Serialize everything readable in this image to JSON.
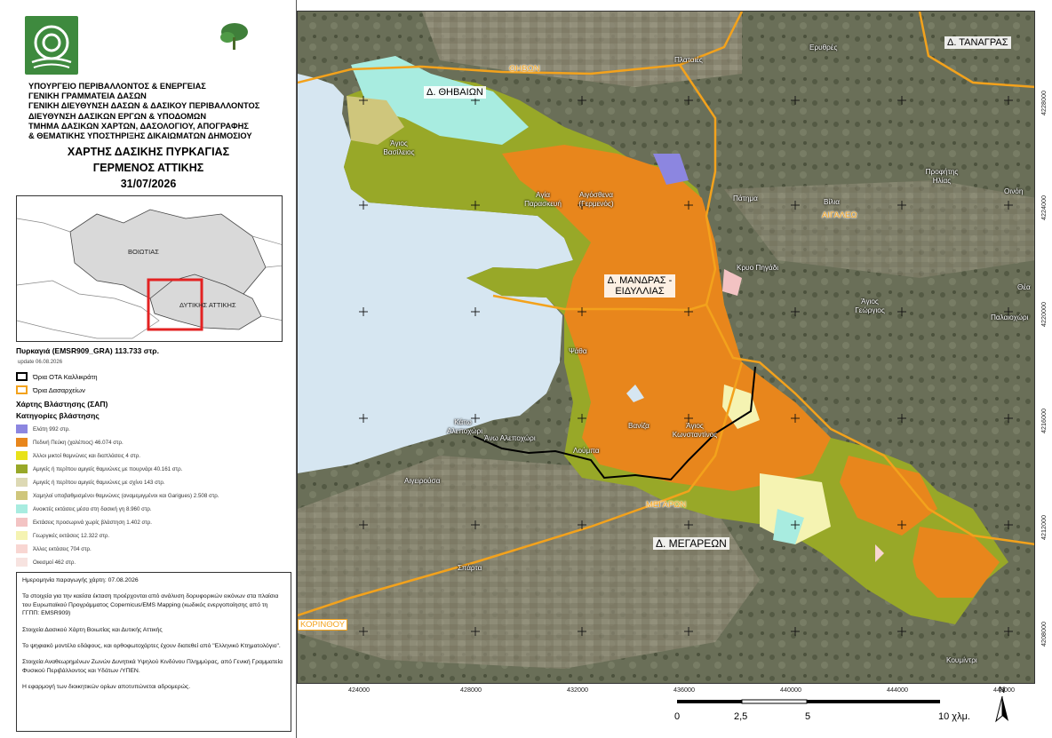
{
  "header": {
    "org_lines": [
      "ΥΠΟΥΡΓΕΙΟ ΠΕΡΙΒΑΛΛΟΝΤΟΣ & ΕΝΕΡΓΕΙΑΣ",
      "ΓΕΝΙΚΗ ΓΡΑΜΜΑΤΕΙΑ ΔΑΣΩΝ",
      "ΓΕΝΙΚΗ ΔΙΕΥΘΥΝΣΗ ΔΑΣΩΝ & ΔΑΣΙΚΟΥ ΠΕΡΙΒΑΛΛΟΝΤΟΣ",
      "ΔΙΕΥΘΥΝΣΗ ΔΑΣΙΚΩΝ ΕΡΓΩΝ & ΥΠΟΔΟΜΩΝ",
      "ΤΜΗΜΑ ΔΑΣΙΚΩΝ ΧΑΡΤΩΝ, ΔΑΣΟΛΟΓΙΟΥ, ΑΠΟΓΡΑΦΗΣ",
      "& ΘΕΜΑΤΙΚΗΣ ΥΠΟΣΤΗΡΙΞΗΣ ΔΙΚΑΙΩΜΑΤΩΝ ΔΗΜΟΣΙΟΥ"
    ],
    "title_1": "ΧΑΡΤΗΣ ΔΑΣΙΚΗΣ ΠΥΡΚΑΓΙΑΣ",
    "title_2": "ΓΕΡΜΕΝΟΣ ΑΤΤΙΚΗΣ",
    "date": "31/07/2026"
  },
  "inset": {
    "label_voiotias": "ΒΟΙΩΤΙΑΣ",
    "label_dytikis": "ΔΥΤΙΚΗΣ ΑΤΤΙΚΗΣ"
  },
  "legend": {
    "fire_title": "Πυρκαγιά (EMSR909_GRA)  113.733 στρ.",
    "fire_update": "update 06.08.2026",
    "ota_line": "Όρια ΟΤΑ Καλλικράτη",
    "dasarx_line": "Όρια Δασαρχείων",
    "vegetation_title": "Χάρτης Βλάστησης (ΣΑΠ)",
    "categories_title": "Κατηγορίες βλάστησης",
    "categories": [
      {
        "label": "Ελάτη 992 στρ.",
        "color": "#8c86e0"
      },
      {
        "label": "Πεδινή Πεύκη (χαλέπιος) 46.074 στρ.",
        "color": "#e8861c"
      },
      {
        "label": "Άλλοι μικτοί θαμνώνες και διαπλάσεις 4 στρ.",
        "color": "#e8e21a"
      },
      {
        "label": "Αμιγείς ή περίπου αμιγείς θαμνώνες με πουρνάρι 40.161 στρ.",
        "color": "#98a828"
      },
      {
        "label": "Αμιγείς ή περίπου αμιγείς θαμνώνες με σχίνο 143 στρ.",
        "color": "#ddd9b4"
      },
      {
        "label": "Χαμηλοί υποβαθμισμένοι θαμνώνες (αναμεμιγμένοι και Garigues) 2.508 στρ.",
        "color": "#cfc67c"
      },
      {
        "label": "Ανοικτές εκτάσεις μέσα στη δασική γη 8.960 στρ.",
        "color": "#a8ece0"
      },
      {
        "label": "Εκτάσεις προσωρινά χωρίς βλάστηση 1.402 στρ.",
        "color": "#f3c3c3"
      },
      {
        "label": "Γεωργικές εκτάσεις 12.322 στρ.",
        "color": "#f5f3b2"
      },
      {
        "label": "Άλλες εκτάσεις 704 στρ.",
        "color": "#f8d6d2"
      },
      {
        "label": "Οικισμοί 462 στρ.",
        "color": "#f7e3e0"
      }
    ]
  },
  "notes": {
    "date_line": "Ημερομηνία παραγωγής χάρτη: 07.08.2026",
    "p1": "Τα στοιχεία για την καείσα έκταση προέρχονται από ανάλυση δορυφορικών εικόνων στα πλαίσια του Ευρωπαϊκού Προγράμματος Copernicus/EMS Mapping (κωδικός ενεργοποίησης από τη ΓΓΠΠ: EMSR909)",
    "p2": "Στοιχεία Δασικού Χάρτη Βοιωτίας και Δυτικής Αττικής",
    "p3": "Το ψηφιακό μοντέλο εδάφους, και ορθοφωτοχάρτες έχουν διατεθεί από \"Ελληνικό Κτηματολόγιο\".",
    "p4": "Στοιχεία Αναθεωρημένων Ζωνών Δυνητικά Υψηλού Κινδύνου Πλημμύρας, από Γενική Γραμματεία Φυσικού Περιβάλλοντος και Υδάτων /ΥΠΕΝ.",
    "p5": "Η εφαρμογή των διοικητικών ορίων αποτυπώνεται αδρομερώς."
  },
  "map": {
    "places": {
      "plataies": "Πλαταιές",
      "erythres": "Ερυθρές",
      "agios_vasileios": "Άγιος Βασίλειος",
      "agia_paraskevi": "Αγία Παρασκευή",
      "aigosthena": "Αιγόσθενα (Γερμενός)",
      "patima": "Πάτημα",
      "vilia": "Βίλια",
      "profitis_ilias": "Προφήτης Ηλίας",
      "oinoi": "Οινόη",
      "kryo_pigadi": "Κρυο Πηγάδι",
      "agios_georgios": "Άγιος Γεώργιος",
      "thea": "Θέα",
      "palaiochori": "Παλαιοχώρι",
      "psatha": "Ψάθα",
      "kato_alepochori": "Κάτω Αλεποχώρι",
      "ano_alepochori": "Άνω Αλεποχώρι",
      "vaniza": "Βανίζα",
      "agios_konstantinos": "Άγιος Κωνσταντίνος",
      "loumpa": "Λούμπα",
      "aigeirousa": "Αιγειρούσα",
      "sparta": "Σπάρτα",
      "koumintri": "Κουμίντρι"
    },
    "regions": {
      "thivaion": "Δ. ΘΗΒΑΙΩΝ",
      "tanagras": "Δ. ΤΑΝΑΓΡΑΣ",
      "mandras": "Δ. ΜΑΝΔΡΑΣ - ΕΙΔΥΛΛΙΑΣ",
      "megareon": "Δ. ΜΕΓΑΡΕΩΝ"
    },
    "forest_offices": {
      "thivon": "ΘΗΒΩΝ",
      "aigaleo": "ΑΙΓΑΛΕΩ",
      "megaron": "ΜΕΓΑΡΩΝ",
      "korinthou": "ΚΟΡΙΝΘΟΥ"
    },
    "x_ticks": [
      "424000",
      "428000",
      "432000",
      "436000",
      "440000",
      "444000",
      "448000"
    ],
    "y_ticks": [
      "4228000",
      "4224000",
      "4220000",
      "4216000",
      "4212000",
      "4208000"
    ],
    "north": "N",
    "scale": {
      "zero": "0",
      "mid1": "2,5",
      "mid2": "5",
      "end": "10 χλμ."
    }
  }
}
